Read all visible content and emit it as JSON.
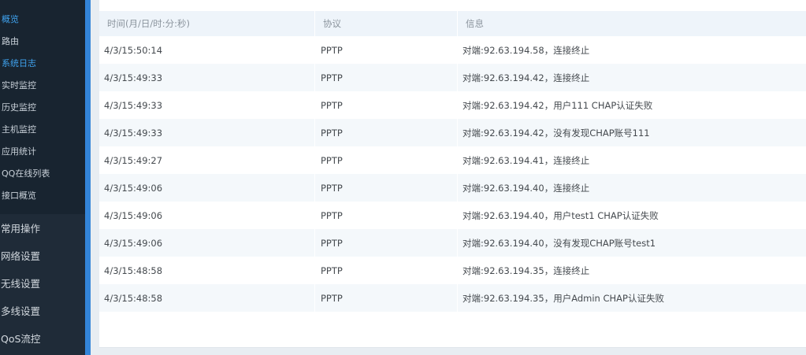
{
  "sidebar": {
    "sub_items": [
      {
        "label": "概览",
        "active": true
      },
      {
        "label": "路由",
        "active": false
      },
      {
        "label": "系统日志",
        "active": true
      },
      {
        "label": "实时监控",
        "active": false
      },
      {
        "label": "历史监控",
        "active": false
      },
      {
        "label": "主机监控",
        "active": false
      },
      {
        "label": "应用统计",
        "active": false
      },
      {
        "label": "QQ在线列表",
        "active": false
      },
      {
        "label": "接口概览",
        "active": false
      }
    ],
    "main_items": [
      {
        "label": "常用操作"
      },
      {
        "label": "网络设置"
      },
      {
        "label": "无线设置"
      },
      {
        "label": "多线设置"
      },
      {
        "label": "QoS流控"
      }
    ]
  },
  "log_table": {
    "headers": [
      "时间(月/日/时:分:秒)",
      "协议",
      "信息"
    ],
    "rows": [
      [
        "4/3/15:50:14",
        "PPTP",
        "对端:92.63.194.58，连接终止"
      ],
      [
        "4/3/15:49:33",
        "PPTP",
        "对端:92.63.194.42，连接终止"
      ],
      [
        "4/3/15:49:33",
        "PPTP",
        "对端:92.63.194.42，用户111 CHAP认证失败"
      ],
      [
        "4/3/15:49:33",
        "PPTP",
        "对端:92.63.194.42，没有发现CHAP账号111"
      ],
      [
        "4/3/15:49:27",
        "PPTP",
        "对端:92.63.194.41，连接终止"
      ],
      [
        "4/3/15:49:06",
        "PPTP",
        "对端:92.63.194.40，连接终止"
      ],
      [
        "4/3/15:49:06",
        "PPTP",
        "对端:92.63.194.40，用户test1 CHAP认证失败"
      ],
      [
        "4/3/15:49:06",
        "PPTP",
        "对端:92.63.194.40，没有发现CHAP账号test1"
      ],
      [
        "4/3/15:48:58",
        "PPTP",
        "对端:92.63.194.35，连接终止"
      ],
      [
        "4/3/15:48:58",
        "PPTP",
        "对端:92.63.194.35，用户Admin CHAP认证失败"
      ]
    ]
  },
  "colors": {
    "sidebar_bg": "#1f2b38",
    "submenu_bg": "#182430",
    "accent_blue": "#3384d8",
    "active_text": "#3fa2ee",
    "header_bg": "#eef4fa",
    "row_alt_bg": "#f4f8fb"
  }
}
